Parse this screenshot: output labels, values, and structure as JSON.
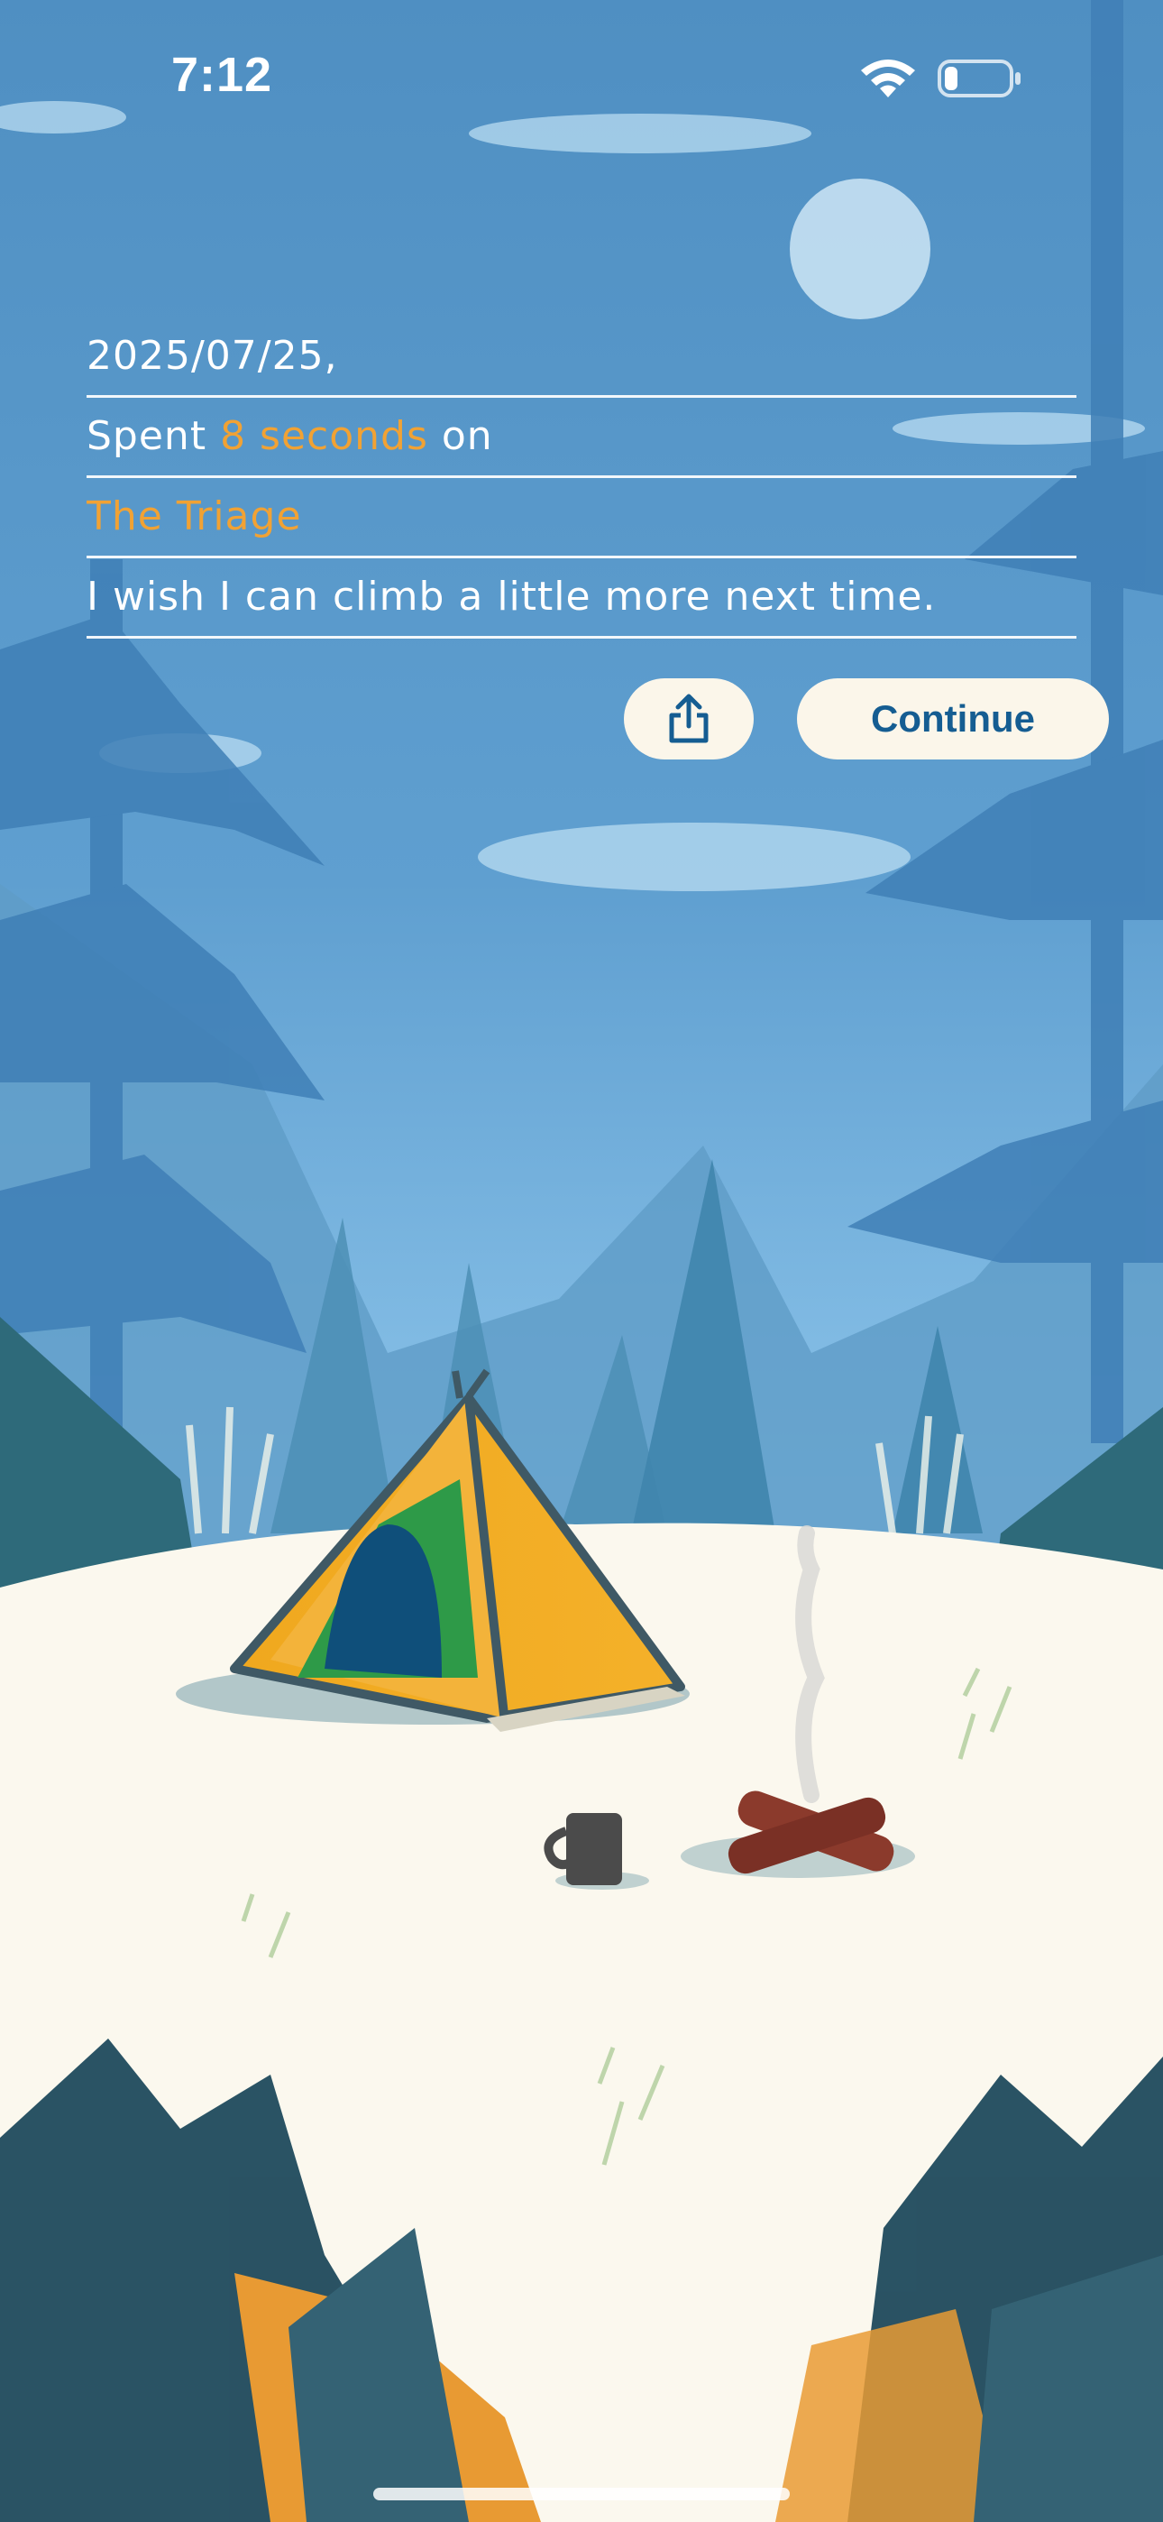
{
  "status_bar": {
    "time": "7:12",
    "wifi_icon": "wifi-icon",
    "battery_icon": "battery-low-icon"
  },
  "journal": {
    "date": "2025/07/25,",
    "spent_prefix": "Spent ",
    "spent_duration": "8 seconds",
    "spent_suffix": " on",
    "title": "The Triage",
    "note": "I wish I can climb a little more next time."
  },
  "actions": {
    "share_icon": "share-icon",
    "continue_label": "Continue"
  },
  "colors": {
    "sky": "#5a9acb",
    "highlight": "#f1a234",
    "button_bg": "#fbf6ea",
    "button_text": "#155d92",
    "snow": "#fbf8ee",
    "tent": "#f0a81e"
  }
}
